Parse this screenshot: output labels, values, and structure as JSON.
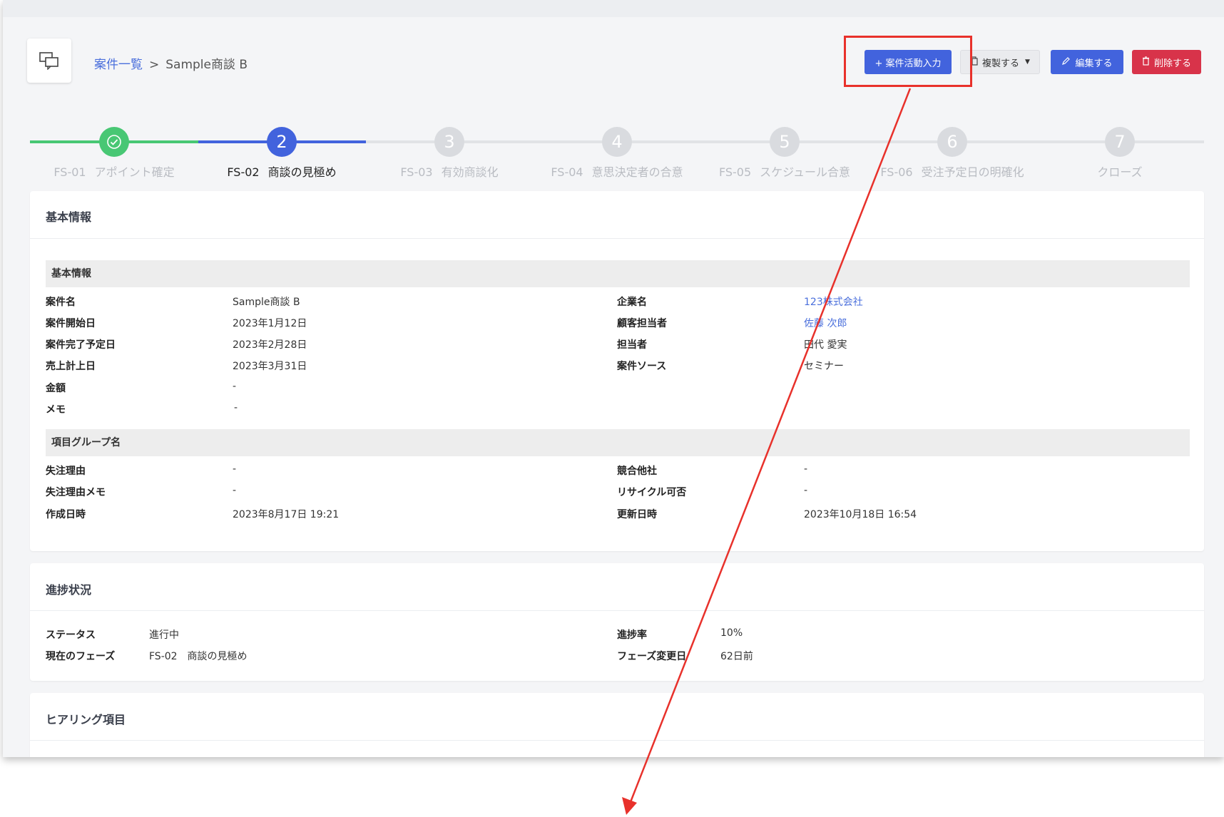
{
  "breadcrumb": {
    "parent": "案件一覧",
    "separator": ">",
    "current": "Sample商談 B"
  },
  "actions": {
    "activity": "+ 案件活動入力",
    "duplicate": "複製する",
    "edit": "編集する",
    "delete": "削除する"
  },
  "colors": {
    "primary": "#4263dd",
    "danger": "#d8334a",
    "done": "#48c774",
    "annotation": "#e8312b"
  },
  "stepper": {
    "current_index": 1,
    "steps": [
      {
        "number": "✓",
        "code": "FS-01",
        "name": "アポイント確定",
        "state": "done"
      },
      {
        "number": "2",
        "code": "FS-02",
        "name": "商談の見極め",
        "state": "current"
      },
      {
        "number": "3",
        "code": "FS-03",
        "name": "有効商談化",
        "state": "pending"
      },
      {
        "number": "4",
        "code": "FS-04",
        "name": "意思決定者の合意",
        "state": "pending"
      },
      {
        "number": "5",
        "code": "FS-05",
        "name": "スケジュール合意",
        "state": "pending"
      },
      {
        "number": "6",
        "code": "FS-06",
        "name": "受注予定日の明確化",
        "state": "pending"
      },
      {
        "number": "7",
        "code": "",
        "name": "クローズ",
        "state": "pending"
      }
    ]
  },
  "basic_info": {
    "title": "基本情報",
    "group1": "基本情報",
    "group2": "項目グループ名",
    "left_rows": [
      {
        "label": "案件名",
        "value": "Sample商談 B"
      },
      {
        "label": "案件開始日",
        "value": "2023年1月12日"
      },
      {
        "label": "案件完了予定日",
        "value": "2023年2月28日"
      },
      {
        "label": "売上計上日",
        "value": "2023年3月31日"
      },
      {
        "label": "金額",
        "value": "-"
      },
      {
        "label": "メモ",
        "value": "-"
      }
    ],
    "right_rows": [
      {
        "label": "企業名",
        "value": "123株式会社"
      },
      {
        "label": "顧客担当者",
        "value": "佐藤 次郎"
      },
      {
        "label": "担当者",
        "value": "田代 愛実"
      },
      {
        "label": "案件ソース",
        "value": "セミナー"
      }
    ],
    "left_rows2": [
      {
        "label": "失注理由",
        "value": "-"
      },
      {
        "label": "失注理由メモ",
        "value": "-"
      },
      {
        "label": "作成日時",
        "value": "2023年8月17日 19:21"
      }
    ],
    "right_rows2": [
      {
        "label": "競合他社",
        "value": "-"
      },
      {
        "label": "リサイクル可否",
        "value": "-"
      },
      {
        "label": "更新日時",
        "value": "2023年10月18日 16:54"
      }
    ]
  },
  "progress": {
    "title": "進捗状況",
    "rows": [
      {
        "label": "ステータス",
        "value": "進行中"
      },
      {
        "label": "現在のフェーズ",
        "value": "FS-02　商談の見極め"
      }
    ],
    "rows_right": [
      {
        "label": "進捗率",
        "value": "10%"
      },
      {
        "label": "フェーズ変更日",
        "value": "62日前"
      }
    ]
  },
  "hearing": {
    "title": "ヒアリング項目"
  }
}
